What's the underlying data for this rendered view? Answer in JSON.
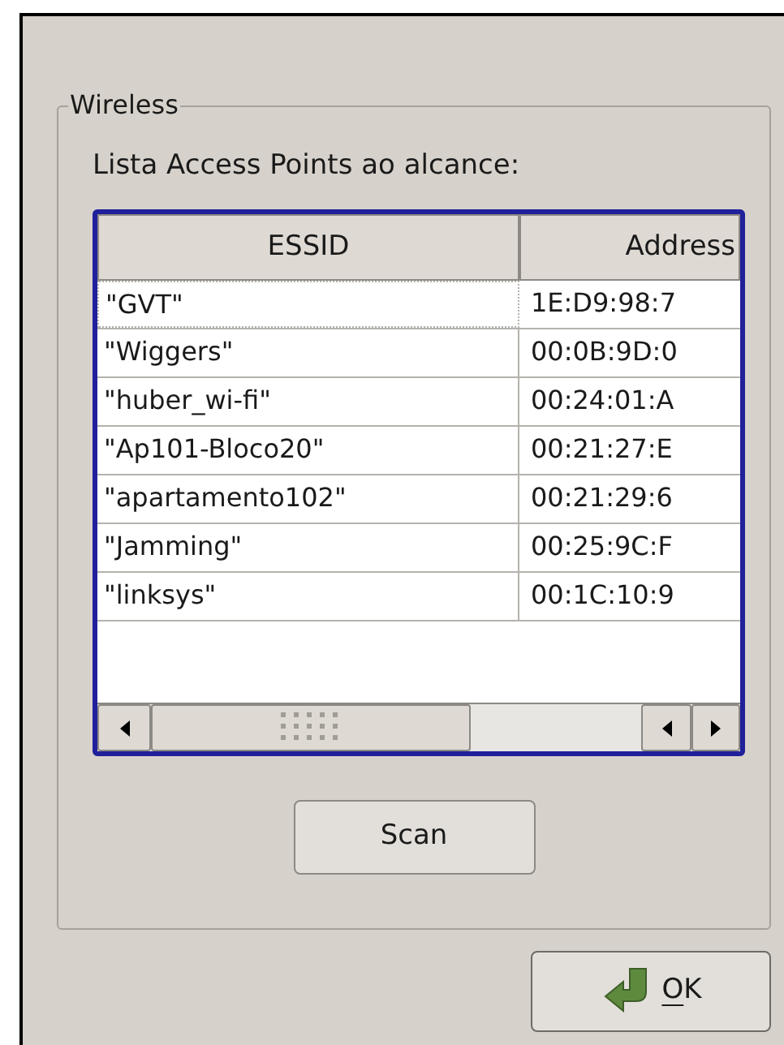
{
  "group": {
    "title": "Wireless"
  },
  "list_label": "Lista Access Points ao alcance:",
  "table": {
    "columns": [
      "ESSID",
      "Address"
    ],
    "rows": [
      {
        "essid": "\"GVT\"",
        "address": "1E:D9:98:7",
        "focused": true
      },
      {
        "essid": "\"Wiggers\"",
        "address": "00:0B:9D:0",
        "focused": false
      },
      {
        "essid": "\"huber_wi-fi\"",
        "address": "00:24:01:A",
        "focused": false
      },
      {
        "essid": "\"Ap101-Bloco20\"",
        "address": "00:21:27:E",
        "focused": false
      },
      {
        "essid": "\"apartamento102\"",
        "address": "00:21:29:6",
        "focused": false
      },
      {
        "essid": "\"Jamming\"",
        "address": "00:25:9C:F",
        "focused": false
      },
      {
        "essid": "\"linksys\"",
        "address": "00:1C:10:9",
        "focused": false
      }
    ]
  },
  "scan_button": "Scan",
  "ok_button": "OK"
}
